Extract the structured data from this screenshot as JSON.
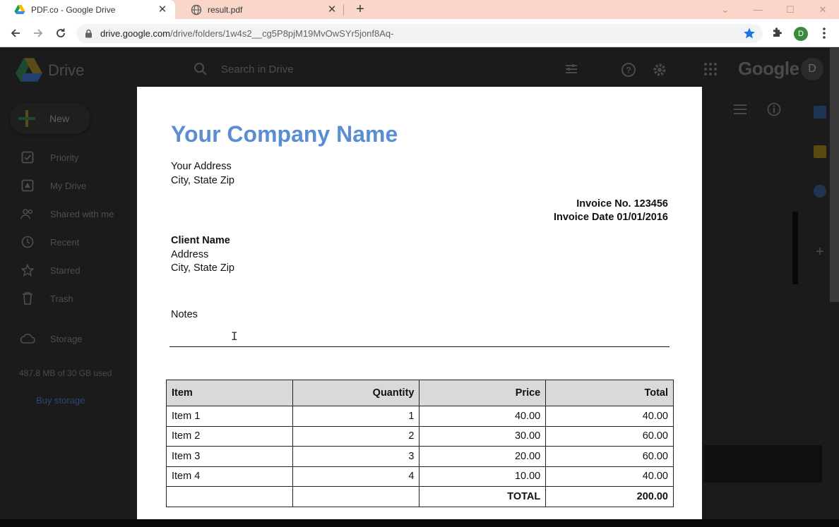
{
  "browser": {
    "tabs": [
      {
        "title": "PDF.co - Google Drive",
        "active": true,
        "icon": "google-drive-icon"
      },
      {
        "title": "result.pdf",
        "active": false,
        "icon": "globe-icon"
      }
    ],
    "address": {
      "host": "drive.google.com",
      "path": "/drive/folders/1w4s2__cg5P8pjM19MvOwSYr5jonf8Aq-"
    },
    "profile_initial": "D"
  },
  "drive": {
    "app_name": "Drive",
    "search_placeholder": "Search in Drive",
    "brand": "Google",
    "avatar_initial": "D",
    "new_label": "New",
    "nav": [
      {
        "label": "Priority",
        "icon": "check-square-icon"
      },
      {
        "label": "My Drive",
        "icon": "drive-folder-icon"
      },
      {
        "label": "Shared with me",
        "icon": "people-icon"
      },
      {
        "label": "Recent",
        "icon": "clock-icon"
      },
      {
        "label": "Starred",
        "icon": "star-icon"
      },
      {
        "label": "Trash",
        "icon": "trash-icon"
      },
      {
        "label": "Storage",
        "icon": "cloud-icon"
      }
    ],
    "storage_used": "487.8 MB of 30 GB used",
    "buy_storage": "Buy storage"
  },
  "invoice": {
    "company": "Your Company Name",
    "company_color": "#5a8ed2",
    "address_line1": "Your Address",
    "address_line2": "City, State Zip",
    "invoice_no": "Invoice No. 123456",
    "invoice_date": "Invoice Date 01/01/2016",
    "client_name": "Client Name",
    "client_address": "Address",
    "client_city": "City, State Zip",
    "notes_label": "Notes",
    "table": {
      "headers": [
        "Item",
        "Quantity",
        "Price",
        "Total"
      ],
      "rows": [
        [
          "Item 1",
          "1",
          "40.00",
          "40.00"
        ],
        [
          "Item 2",
          "2",
          "30.00",
          "60.00"
        ],
        [
          "Item 3",
          "3",
          "20.00",
          "60.00"
        ],
        [
          "Item 4",
          "4",
          "10.00",
          "40.00"
        ]
      ],
      "total_label": "TOTAL",
      "total_value": "200.00"
    }
  }
}
